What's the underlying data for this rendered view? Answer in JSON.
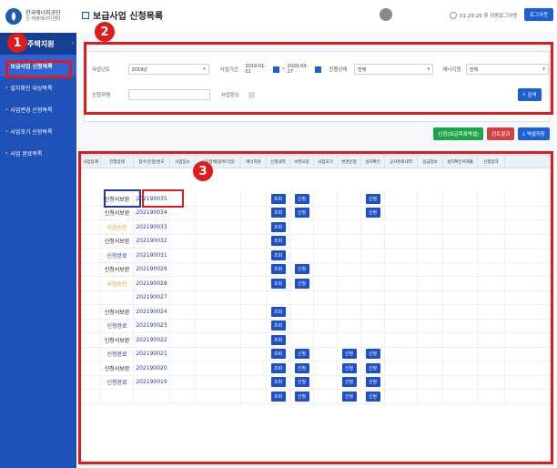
{
  "brand": {
    "line1": "한국에너지공단",
    "line2": "신·재생에너지센터"
  },
  "header": {
    "title": "보급사업 신청목록",
    "timer_text": "01:29:25 후 자동로그아웃",
    "logout_label": "로그아웃"
  },
  "sidebar": {
    "title": "주택지원",
    "items": [
      {
        "label": "보급사업 신청목록",
        "active": true
      },
      {
        "label": "설치확인 대상목록",
        "active": false
      },
      {
        "label": "사업변경 신청목록",
        "active": false
      },
      {
        "label": "사업포기 신청목록",
        "active": false
      },
      {
        "label": "사업 완료목록",
        "active": false
      }
    ]
  },
  "filters": {
    "year_label": "사업년도",
    "year_value": "2019년",
    "period_label": "사업기간",
    "period_start": "2019-01-01",
    "period_sep": "~",
    "period_end": "2020-03-27",
    "status_label": "진행상태",
    "status_value": "전체",
    "energy_label": "에너지원",
    "energy_value": "전체",
    "applicant_label": "신청자명",
    "applicant_value": "",
    "address_label": "사업장소",
    "search_label": "검색"
  },
  "actions": {
    "btn1": "신청(보급목록엑셀)",
    "btn2": "검토결과",
    "btn3": "엑셀저장"
  },
  "grid": {
    "headers": [
      "사업승계",
      "진행상태",
      "접수(신청)번호",
      "사업장소",
      "시공업체(참여기업)",
      "에너지원",
      "신청내역",
      "보완요청",
      "사업포기",
      "변경신청",
      "설치확인",
      "공사완료내역",
      "입금정보",
      "설치확인서제출",
      "신청일자"
    ],
    "rows": [
      {
        "status": "신청서보완",
        "status_color": "black",
        "app_no": "202190035",
        "c1": "조회",
        "c2": "신청",
        "c3": "",
        "c4": "신청"
      },
      {
        "status": "신청서보완",
        "status_color": "black",
        "app_no": "202190034",
        "c1": "조회",
        "c2": "신청",
        "c3": "",
        "c4": "신청"
      },
      {
        "status": "사업승인",
        "status_color": "orange",
        "app_no": "202190033",
        "c1": "조회",
        "c2": "",
        "c3": "",
        "c4": ""
      },
      {
        "status": "신청서보완",
        "status_color": "black",
        "app_no": "202190032",
        "c1": "조회",
        "c2": "",
        "c3": "",
        "c4": ""
      },
      {
        "status": "신청완료",
        "status_color": "blue",
        "app_no": "202190031",
        "c1": "조회",
        "c2": "",
        "c3": "",
        "c4": ""
      },
      {
        "status": "신청서보완",
        "status_color": "black",
        "app_no": "202190029",
        "c1": "조회",
        "c2": "신청",
        "c3": "",
        "c4": ""
      },
      {
        "status": "사업승인",
        "status_color": "orange",
        "app_no": "202190028",
        "c1": "조회",
        "c2": "신청",
        "c3": "",
        "c4": ""
      },
      {
        "status": "",
        "status_color": "black",
        "app_no": "202190027",
        "c1": "",
        "c2": "",
        "c3": "",
        "c4": ""
      },
      {
        "status": "신청서보완",
        "status_color": "black",
        "app_no": "202190024",
        "c1": "조회",
        "c2": "",
        "c3": "",
        "c4": ""
      },
      {
        "status": "신청완료",
        "status_color": "blue",
        "app_no": "202190023",
        "c1": "조회",
        "c2": "",
        "c3": "",
        "c4": ""
      },
      {
        "status": "신청서보완",
        "status_color": "black",
        "app_no": "202190022",
        "c1": "조회",
        "c2": "",
        "c3": "",
        "c4": ""
      },
      {
        "status": "신청완료",
        "status_color": "blue",
        "app_no": "202190021",
        "c1": "조회",
        "c2": "신청",
        "c3": "신청",
        "c4": "신청"
      },
      {
        "status": "신청서보완",
        "status_color": "black",
        "app_no": "202190020",
        "c1": "조회",
        "c2": "신청",
        "c3": "신청",
        "c4": "신청"
      },
      {
        "status": "신청완료",
        "status_color": "blue",
        "app_no": "202190019",
        "c1": "조회",
        "c2": "신청",
        "c3": "신청",
        "c4": "신청"
      },
      {
        "status": "",
        "status_color": "black",
        "app_no": "",
        "c1": "조회",
        "c2": "신청",
        "c3": "신청",
        "c4": "신청"
      }
    ]
  },
  "annotations": {
    "m1": "1",
    "m2": "2",
    "m3": "3"
  },
  "colors": {
    "sidebar_bg": "#1f52b8",
    "primary": "#1f5fd6",
    "annotation_red": "#e01b1b",
    "annotation_blue": "#1e3aa8",
    "status_orange": "#e09a1a"
  }
}
